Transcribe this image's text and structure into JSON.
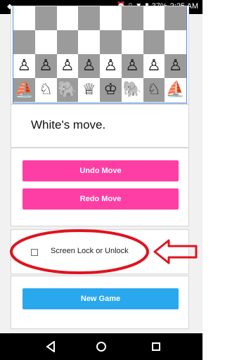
{
  "status_bar": {
    "time": "2:25 AM",
    "battery": "37%",
    "icons": [
      "notification-icon",
      "alarm-icon",
      "vibrate-icon",
      "wifi-icon",
      "battery-icon"
    ]
  },
  "board": {
    "rank_top_1": [
      "",
      "",
      "",
      "",
      "",
      "",
      "",
      ""
    ],
    "rank_top_2": [
      "",
      "",
      "",
      "",
      "",
      "",
      "",
      ""
    ],
    "pawns": [
      "♙",
      "♙",
      "♙",
      "♙",
      "♙",
      "♙",
      "♙",
      "♙"
    ],
    "back_rank": [
      "⛵",
      "♘",
      "🐘",
      "♕",
      "♔",
      "🐘",
      "♘",
      "⛵"
    ]
  },
  "turn": {
    "text": "White's move."
  },
  "buttons": {
    "undo": "Undo Move",
    "redo": "Redo Move",
    "new_game": "New Game"
  },
  "lock": {
    "label": "Screen Lock or Unlock",
    "checked": false
  },
  "colors": {
    "pink": "#ff3ea5",
    "blue": "#2aa8ee",
    "annotation_red": "#e0131f"
  }
}
